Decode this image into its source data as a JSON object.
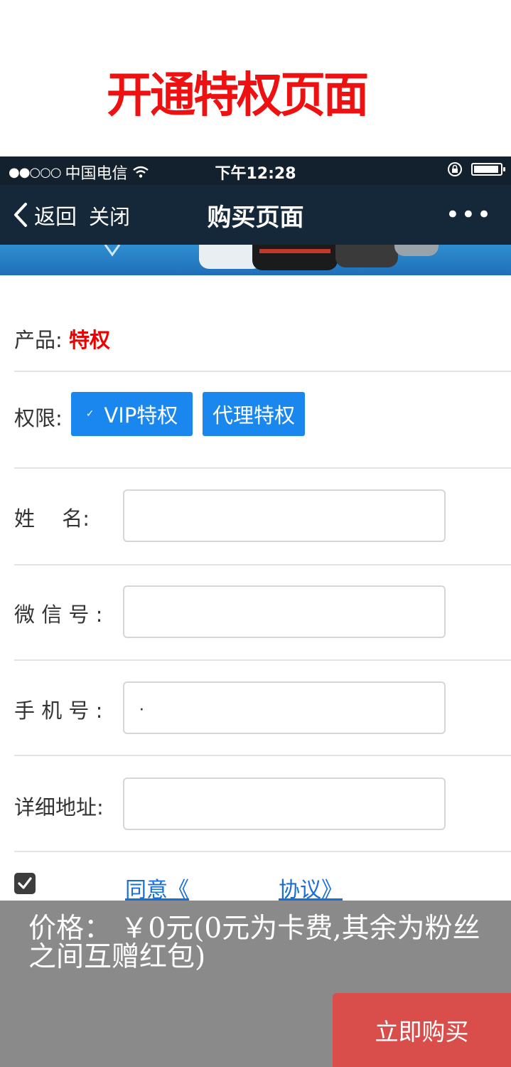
{
  "heading": {
    "title": "开通特权页面"
  },
  "status_bar": {
    "signal": "●●○○○",
    "carrier": "中国电信",
    "time": "下午12:28",
    "battery_level": 0.95
  },
  "nav": {
    "back_label": "返回",
    "close_label": "关闭",
    "title": "购买页面",
    "more_label": "•••"
  },
  "form": {
    "product_label": "产品:",
    "product_value": "特权",
    "permission_label": "权限:",
    "permission_options": [
      {
        "label": "VIP特权",
        "selected": true
      },
      {
        "label": "代理特权",
        "selected": false
      }
    ],
    "name_label": "姓　 名:",
    "wechat_label": "微 信 号 :",
    "phone_label": "手 机 号 :",
    "phone_value": "·",
    "address_label": "详细地址:",
    "agree_checked": true,
    "agree_text_1": "同意《",
    "agree_text_2": "协议》"
  },
  "footer": {
    "price_text": "价格： ￥0元(0元为卡费,其余为粉丝之间互赠红包)",
    "buy_label": "立即购买"
  },
  "colors": {
    "accent_blue": "#1a87ef",
    "buy_red": "#d94e4b",
    "nav_bg": "#15283a",
    "title_red": "#ee1111"
  }
}
